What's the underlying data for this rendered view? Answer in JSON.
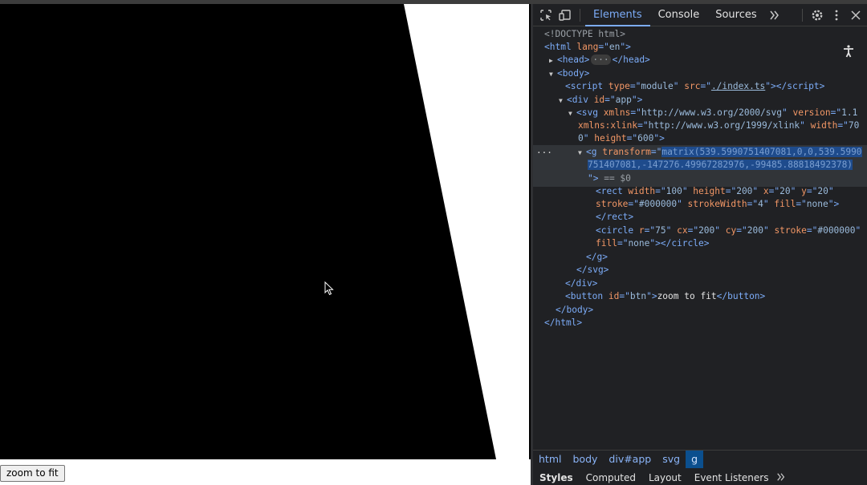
{
  "page": {
    "button_label": "zoom to fit",
    "colors": {
      "shape_fill": "#000000",
      "background": "#ffffff"
    }
  },
  "devtools": {
    "icons": [
      "inspect-element-icon",
      "device-toolbar-icon",
      "more-tabs-icon",
      "settings-icon",
      "kebab-menu-icon",
      "close-icon",
      "accessibility-icon"
    ],
    "tabs": [
      {
        "label": "Elements",
        "active": true
      },
      {
        "label": "Console",
        "active": false
      },
      {
        "label": "Sources",
        "active": false
      }
    ],
    "dom": {
      "doctype": "<!DOCTYPE html>",
      "html_open": "<html lang=\"en\">",
      "head": "<head>",
      "head_ellipsis": "···",
      "head_close": "</head>",
      "body_open": "<body>",
      "script": {
        "tag": "script",
        "type": "module",
        "src": "./index.ts"
      },
      "div_app": {
        "tag": "div",
        "id": "app"
      },
      "svg_line1": {
        "tag": "svg",
        "xmlns": "http://www.w3.org/2000/svg",
        "version": "1.1"
      },
      "svg_line2": {
        "xmlns_xlink": "http://www.w3.org/1999/xlink",
        "width_part1": "70"
      },
      "svg_line3": {
        "width_part2": "0",
        "height": "600"
      },
      "g_transform_part1": "matrix(539.5990751407081,0,0,539.5990",
      "g_transform_part2": "751407081,-147276.49967282976,-99485.88818492378)",
      "selected_marker": "== $0",
      "rect": {
        "width": "100",
        "height": "200",
        "x": "20",
        "y": "20",
        "stroke": "#000000",
        "strokeWidth": "4",
        "fill": "none"
      },
      "circle": {
        "r": "75",
        "cx": "200",
        "cy": "200",
        "stroke": "#000000",
        "fill": "none"
      },
      "button": {
        "id": "btn",
        "text": "zoom to fit"
      }
    },
    "breadcrumbs": [
      "html",
      "body",
      "div#app",
      "svg",
      "g"
    ],
    "subtabs": [
      "Styles",
      "Computed",
      "Layout",
      "Event Listeners"
    ],
    "colors": {
      "panel_bg": "#202124",
      "accent": "#7cacf8",
      "tag": "#7cacf8",
      "attr": "#f29766",
      "selection": "#1e4b8c"
    }
  }
}
